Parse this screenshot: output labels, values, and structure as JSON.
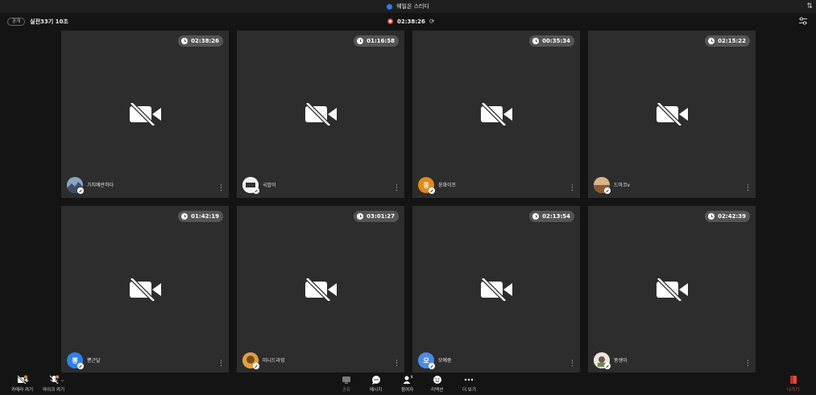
{
  "window": {
    "title": "웨일온 스터디",
    "sort_icon": "sort-icon"
  },
  "room": {
    "badge": "공개",
    "name": "실전33기 10조",
    "elapsed": "02:38:26",
    "record_icon": "record-icon",
    "refresh_icon": "refresh-icon",
    "settings_icon": "settings-sliders-icon"
  },
  "tiles": [
    {
      "time": "02:38:26",
      "name": "가치예반하다",
      "avatar_text": "",
      "avatar_color": "#5a6f8c"
    },
    {
      "time": "01:16:58",
      "name": "국밥이",
      "avatar_text": "",
      "avatar_color": "#f2f2f2"
    },
    {
      "time": "00:35:34",
      "name": "웅화이프",
      "avatar_text": "웅",
      "avatar_color": "#e08a1e"
    },
    {
      "time": "02:15:22",
      "name": "드마코v",
      "avatar_text": "",
      "avatar_color": "#b07d4e"
    },
    {
      "time": "01:42:19",
      "name": "뽕근달",
      "avatar_text": "뽕",
      "avatar_color": "#2f80ed"
    },
    {
      "time": "03:01:27",
      "name": "미니드라밍",
      "avatar_text": "",
      "avatar_color": "#c9852f"
    },
    {
      "time": "02:13:54",
      "name": "모예중",
      "avatar_text": "모",
      "avatar_color": "#4a8be8"
    },
    {
      "time": "02:42:39",
      "name": "쫑생이",
      "avatar_text": "",
      "avatar_color": "#e9e4dc"
    }
  ],
  "toolbar": {
    "camera": "카메라 켜기",
    "mic": "마이크 켜기",
    "share": "공유",
    "message": "메시지",
    "participants": "참여자",
    "participants_count": "8",
    "reaction": "리액션",
    "more": "더 보기",
    "leave": "나가기"
  },
  "colors": {
    "accent": "#2f7bf5",
    "danger": "#e5483c",
    "tile_bg": "#2d2d2d",
    "app_bg": "#141414"
  }
}
